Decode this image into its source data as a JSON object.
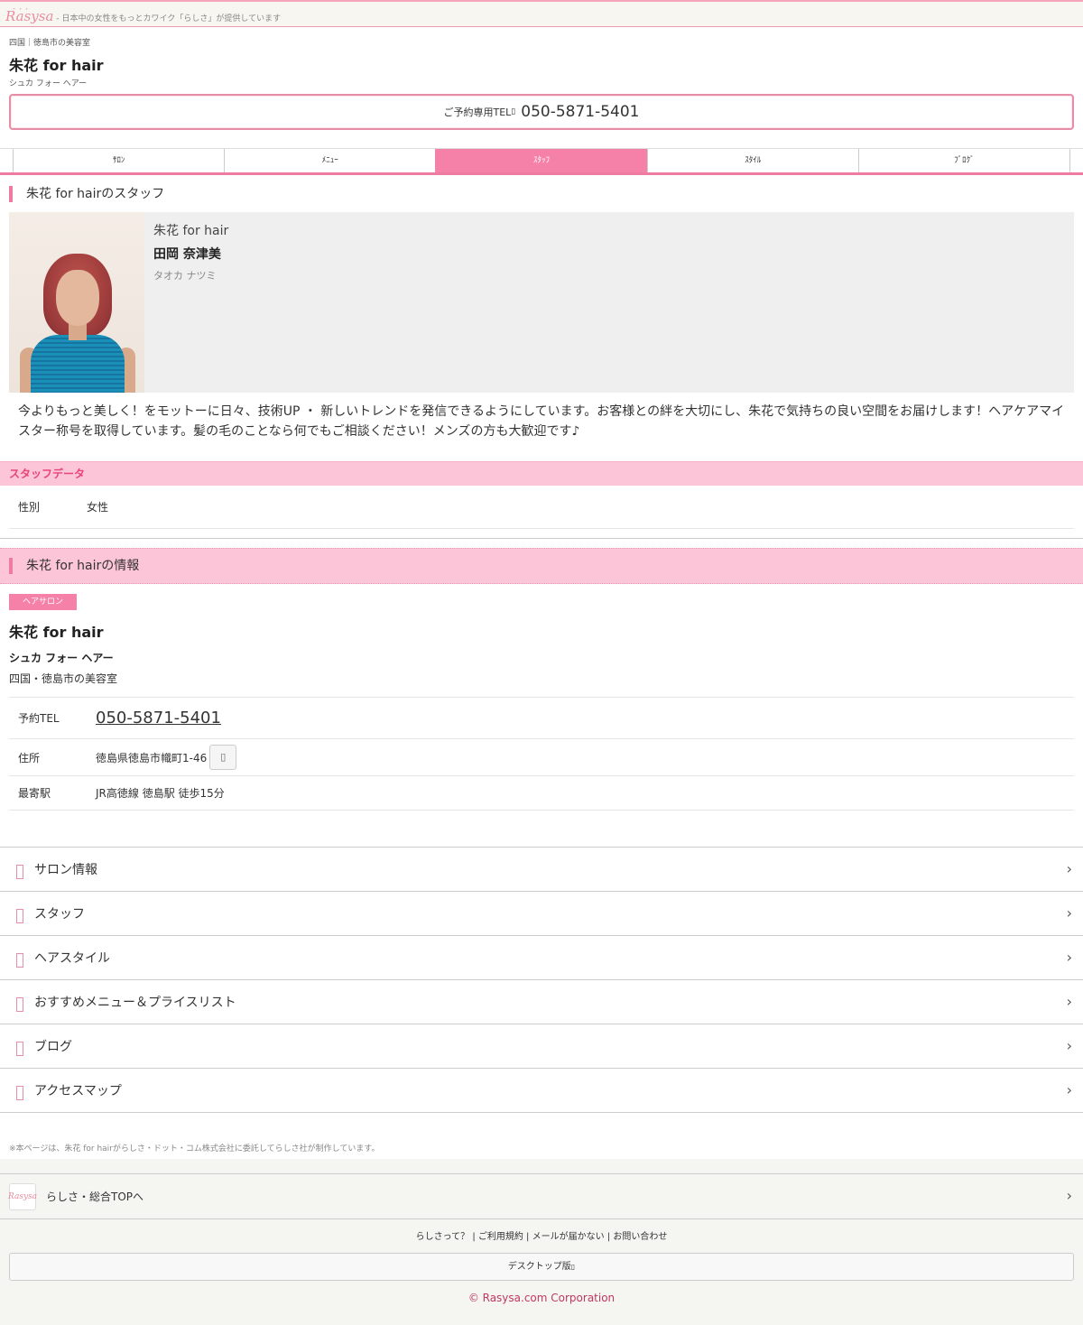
{
  "header": {
    "logo": "Rasysa",
    "tagline": "- 日本中の女性をもっとカワイク「らしさ」が提供しています"
  },
  "salon": {
    "area": "四国｜徳島市の美容室",
    "name": "朱花 for hair",
    "kana": "シュカ フォー ヘアー",
    "tel_label": "ご予約専用TEL",
    "tel_icon": "phone-icon",
    "tel": "050-5871-5401"
  },
  "nav": {
    "items": [
      {
        "label": "ｻﾛﾝ",
        "active": false
      },
      {
        "label": "ﾒﾆｭｰ",
        "active": false
      },
      {
        "label": "ｽﾀｯﾌ",
        "active": true
      },
      {
        "label": "ｽﾀｲﾙ",
        "active": false
      },
      {
        "label": "ﾌﾞﾛｸﾞ",
        "active": false
      }
    ]
  },
  "staff_section": {
    "title": "朱花 for hairのスタッフ"
  },
  "staff": {
    "salon": "朱花 for hair",
    "name": "田岡 奈津美",
    "kana": "タオカ ナツミ",
    "description": "今よりもっと美しく！をモットーに日々、技術UP ・ 新しいトレンドを発信できるようにしています。お客様との絆を大切にし、朱花で気持ちの良い空間をお届けします！ヘアケアマイスター称号を取得しています。髪の毛のことなら何でもご相談ください！メンズの方も大歓迎です♪"
  },
  "staff_data": {
    "title": "スタッフデータ",
    "rows": [
      {
        "key": "性別",
        "value": "女性"
      }
    ]
  },
  "info_section": {
    "title": "朱花 for hairの情報",
    "badge": "ヘアサロン",
    "name": "朱花 for hair",
    "kana": "シュカ フォー ヘアー",
    "area": "四国・徳島市の美容室",
    "tel_key": "予約TEL",
    "tel": "050-5871-5401",
    "address_key": "住所",
    "address": "徳島県徳島市幟町1-46",
    "map_icon": "map-icon",
    "station_key": "最寄駅",
    "station": "JR高徳線 徳島駅 徒歩15分"
  },
  "menu": {
    "items": [
      {
        "label": "サロン情報",
        "icon": "document-icon"
      },
      {
        "label": "スタッフ",
        "icon": "person-icon"
      },
      {
        "label": "ヘアスタイル",
        "icon": "scissors-icon"
      },
      {
        "label": "おすすめメニュー＆プライスリスト",
        "icon": "list-icon"
      },
      {
        "label": "ブログ",
        "icon": "pen-icon"
      },
      {
        "label": "アクセスマップ",
        "icon": "map-icon"
      }
    ]
  },
  "note": "※本ページは、朱花 for hairがらしさ・ドット・コム株式会社に委託してらしさ社が制作しています。",
  "footer": {
    "top_link": "らしさ・総合TOPへ",
    "logo": "Rasysa",
    "links": "らしさって？ | ご利用規約 | メールが届かない | お問い合わせ",
    "desktop": "デスクトップ版",
    "copyright": "© Rasysa.com Corporation"
  },
  "colors": {
    "accent": "#f580a8",
    "accent_light": "#fdc5d8",
    "copyright": "#c0395e"
  }
}
